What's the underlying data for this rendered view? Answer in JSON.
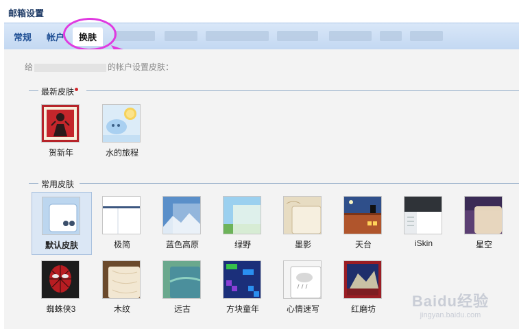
{
  "page": {
    "title": "邮箱设置"
  },
  "tabs": [
    {
      "label": "常规",
      "active": false
    },
    {
      "label": "帐户",
      "active": false
    },
    {
      "label": "换肤",
      "active": true
    }
  ],
  "description": {
    "prefix": "给",
    "suffix": "的帐户设置皮肤："
  },
  "sections": {
    "latest": {
      "label": "最新皮肤",
      "new_badge": true
    },
    "common": {
      "label": "常用皮肤"
    }
  },
  "skins": {
    "latest": [
      {
        "name": "贺新年",
        "icon": "new-year-thumb"
      },
      {
        "name": "水的旅程",
        "icon": "water-journey-thumb"
      }
    ],
    "common": [
      {
        "name": "默认皮肤",
        "icon": "default-skin-thumb",
        "selected": true
      },
      {
        "name": "极简",
        "icon": "minimal-thumb"
      },
      {
        "name": "蓝色高原",
        "icon": "blue-plateau-thumb"
      },
      {
        "name": "绿野",
        "icon": "green-field-thumb"
      },
      {
        "name": "墨影",
        "icon": "ink-shadow-thumb"
      },
      {
        "name": "天台",
        "icon": "rooftop-thumb"
      },
      {
        "name": "iSkin",
        "icon": "iskin-thumb"
      },
      {
        "name": "星空",
        "icon": "starry-sky-thumb"
      },
      {
        "name": "蜘蛛侠3",
        "icon": "spiderman-thumb"
      },
      {
        "name": "木纹",
        "icon": "wood-grain-thumb"
      },
      {
        "name": "远古",
        "icon": "ancient-thumb"
      },
      {
        "name": "方块童年",
        "icon": "block-childhood-thumb"
      },
      {
        "name": "心情速写",
        "icon": "mood-sketch-thumb"
      },
      {
        "name": "红磨坊",
        "icon": "red-mill-thumb"
      }
    ]
  },
  "watermark": {
    "brand": "Baidu经验",
    "url": "jingyan.baidu.com"
  },
  "colors": {
    "tab_active": "#ffffff",
    "tab_text": "#1f4f94",
    "highlight_circle": "#e03ae0",
    "badge": "#d2282d"
  }
}
